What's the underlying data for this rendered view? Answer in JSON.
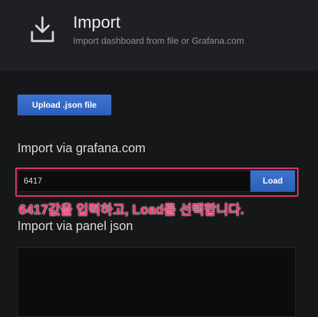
{
  "header": {
    "title": "Import",
    "subtitle": "Import dashboard from file or Grafana.com",
    "icon": "download-icon"
  },
  "upload": {
    "label": "Upload .json file"
  },
  "grafana_section": {
    "title": "Import via grafana.com",
    "input_value": "6417",
    "load_label": "Load"
  },
  "panel_json": {
    "title": "Import via panel json"
  },
  "annotation": {
    "text": "6417값을 입력하고, Load를 선택합니다."
  },
  "colors": {
    "accent": "#3d73d1",
    "highlight": "#e8386b",
    "background": "#161719",
    "header_background": "#1f2023"
  }
}
